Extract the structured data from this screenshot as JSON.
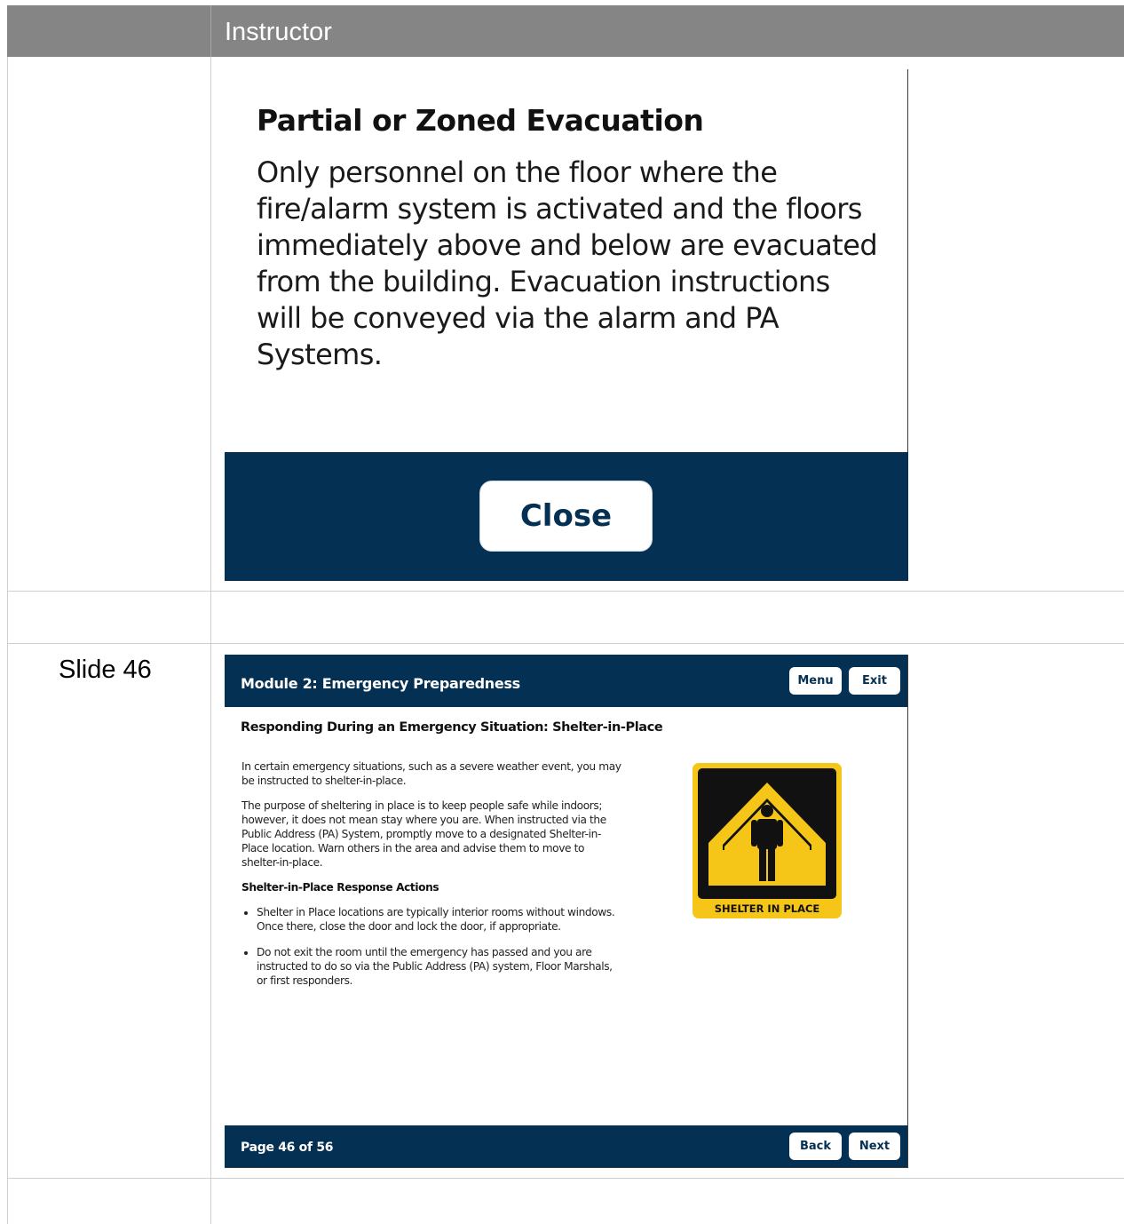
{
  "table": {
    "header_label": "Instructor",
    "row_label": "Slide 46"
  },
  "popup": {
    "title": "Partial or Zoned Evacuation",
    "body": "Only personnel on the floor where the fire/alarm system is activated and the floors immediately above and below are evacuated from the building.  Evacuation instructions will be conveyed via the alarm and PA Systems.",
    "close_label": "Close"
  },
  "slide": {
    "module_title": "Module 2: Emergency Preparedness",
    "menu_label": "Menu",
    "exit_label": "Exit",
    "heading": "Responding During an Emergency Situation: Shelter-in-Place",
    "para1": "In certain emergency situations, such as a severe weather event, you may be instructed to shelter-in-place.",
    "para2": "The purpose of sheltering in place is to keep people safe while indoors; however, it does not mean stay where you are. When instructed via the Public Address (PA) System, promptly move to a designated Shelter-in-Place location. Warn others in the area and advise them to move to shelter-in-place.",
    "subheading": "Shelter-in-Place Response Actions",
    "bullets": [
      "Shelter in Place locations are typically interior rooms without windows. Once there, close the door and lock the door, if appropriate.",
      "Do not exit the room until the emergency has passed and you are instructed to do so via the Public Address (PA) system, Floor Marshals, or first responders."
    ],
    "sign_text": "SHELTER IN PLACE",
    "page_label": "Page 46 of 56",
    "back_label": "Back",
    "next_label": "Next"
  },
  "colors": {
    "header_gray": "#858585",
    "navy": "#043053",
    "sign_yellow": "#f5c518"
  }
}
